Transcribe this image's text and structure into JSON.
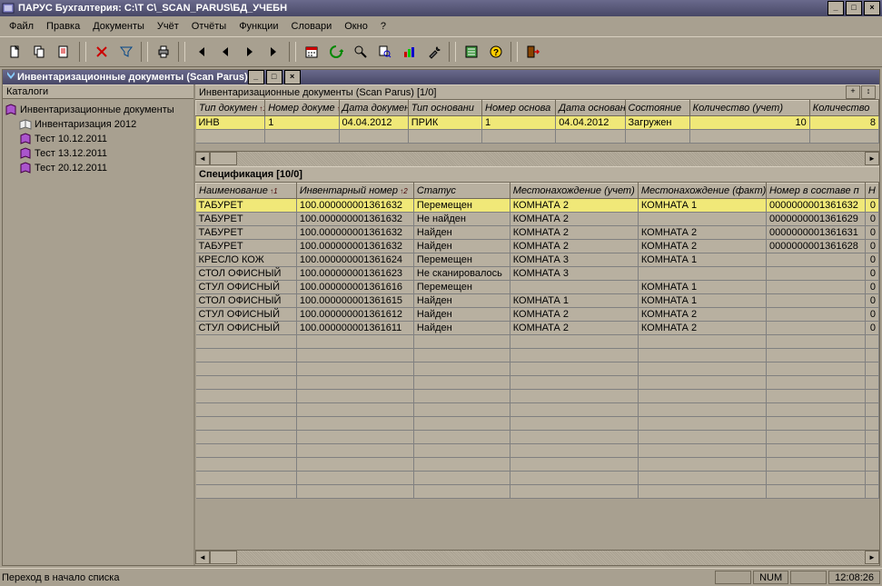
{
  "app_title": "ПАРУС Бухгалтерия: C:\\T C\\_SCAN_PARUS\\БД_УЧЕБН",
  "menu": [
    "Файл",
    "Правка",
    "Документы",
    "Учёт",
    "Отчёты",
    "Функции",
    "Словари",
    "Окно",
    "?"
  ],
  "inner_title": "Инвентаризационные документы (Scan Parus)",
  "left_header": "Каталоги",
  "tree": {
    "root": "Инвентаризационные документы",
    "children": [
      "Инвентаризация 2012",
      "Тест 10.12.2011",
      "Тест 13.12.2011",
      "Тест 20.12.2011"
    ]
  },
  "docs": {
    "title": "Инвентаризационные документы (Scan Parus) [1/0]",
    "cols": [
      "Тип докумен",
      "Номер докуме",
      "Дата докумен",
      "Тип основани",
      "Номер основа",
      "Дата основан",
      "Состояние",
      "Количество (учет)",
      "Количество"
    ],
    "rows": [
      {
        "type": "ИНВ",
        "num": "1",
        "date": "04.04.2012",
        "btype": "ПРИК",
        "bnum": "1",
        "bdate": "04.04.2012",
        "state": "Загружен",
        "qty_acc": "10",
        "qty": "8"
      }
    ]
  },
  "spec": {
    "title": "Спецификация [10/0]",
    "cols": [
      "Наименование",
      "Инвентарный номер",
      "Статус",
      "Местонахождение (учет)",
      "Местонахождение (факт)",
      "Номер в составе п",
      "Н"
    ],
    "rows": [
      {
        "name": "ТАБУРЕТ",
        "inv": "100.000000001361632",
        "status": "Перемещен",
        "loc_a": "КОМНАТА 2",
        "loc_f": "КОМНАТА 1",
        "grp": "0000000001361632",
        "n": "0"
      },
      {
        "name": "ТАБУРЕТ",
        "inv": "100.000000001361632",
        "status": "Не найден",
        "loc_a": "КОМНАТА 2",
        "loc_f": "",
        "grp": "0000000001361629",
        "n": "0"
      },
      {
        "name": "ТАБУРЕТ",
        "inv": "100.000000001361632",
        "status": "Найден",
        "loc_a": "КОМНАТА 2",
        "loc_f": "КОМНАТА 2",
        "grp": "0000000001361631",
        "n": "0"
      },
      {
        "name": "ТАБУРЕТ",
        "inv": "100.000000001361632",
        "status": "Найден",
        "loc_a": "КОМНАТА 2",
        "loc_f": "КОМНАТА 2",
        "grp": "0000000001361628",
        "n": "0"
      },
      {
        "name": "КРЕСЛО КОЖ",
        "inv": "100.000000001361624",
        "status": "Перемещен",
        "loc_a": "КОМНАТА 3",
        "loc_f": "КОМНАТА 1",
        "grp": "",
        "n": "0"
      },
      {
        "name": "СТОЛ ОФИСНЫЙ",
        "inv": "100.000000001361623",
        "status": "Не сканировалось",
        "loc_a": "КОМНАТА 3",
        "loc_f": "",
        "grp": "",
        "n": "0"
      },
      {
        "name": "СТУЛ ОФИСНЫЙ",
        "inv": "100.000000001361616",
        "status": "Перемещен",
        "loc_a": "",
        "loc_f": "КОМНАТА 1",
        "grp": "",
        "n": "0"
      },
      {
        "name": "СТОЛ ОФИСНЫЙ",
        "inv": "100.000000001361615",
        "status": "Найден",
        "loc_a": "КОМНАТА 1",
        "loc_f": "КОМНАТА 1",
        "grp": "",
        "n": "0"
      },
      {
        "name": "СТУЛ ОФИСНЫЙ",
        "inv": "100.000000001361612",
        "status": "Найден",
        "loc_a": "КОМНАТА 2",
        "loc_f": "КОМНАТА 2",
        "grp": "",
        "n": "0"
      },
      {
        "name": "СТУЛ ОФИСНЫЙ",
        "inv": "100.000000001361611",
        "status": "Найден",
        "loc_a": "КОМНАТА 2",
        "loc_f": "КОМНАТА 2",
        "grp": "",
        "n": "0"
      }
    ]
  },
  "status": {
    "msg": "Переход в начало списка",
    "num": "NUM",
    "time": "12:08:26"
  }
}
